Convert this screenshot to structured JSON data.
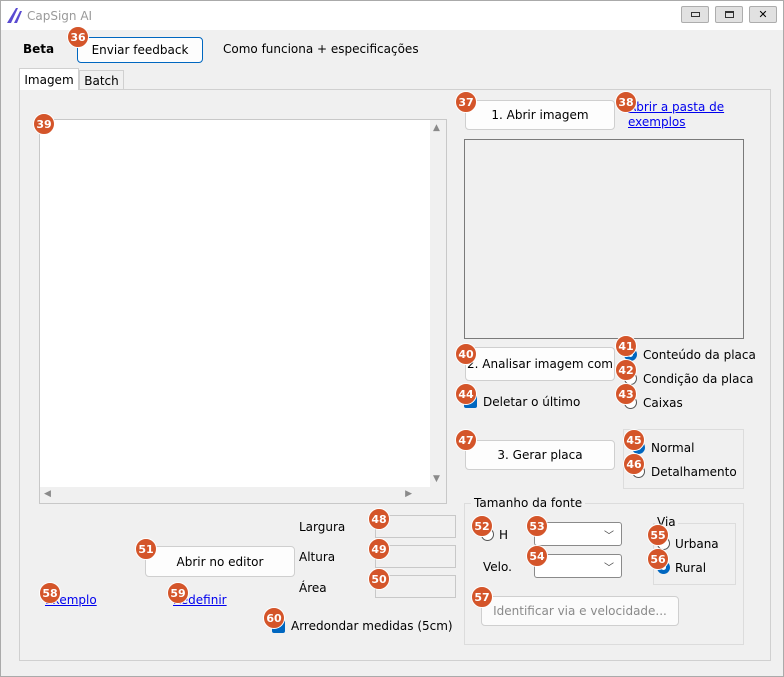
{
  "window": {
    "title": "CapSign AI",
    "controls": {
      "minimize": "▭",
      "maximize": "▢",
      "close": "✕"
    }
  },
  "header": {
    "beta_label": "Beta",
    "feedback_button": "Enviar feedback",
    "how_it_works_label": "Como funciona + especificações"
  },
  "tabs": [
    {
      "label": "Imagem",
      "active": true
    },
    {
      "label": "Batch",
      "active": false
    }
  ],
  "image_panel": {
    "scroll_up": "▲",
    "scroll_down": "▼",
    "scroll_left": "◀",
    "scroll_right": "▶"
  },
  "dimensions": {
    "width_label": "Largura",
    "height_label": "Altura",
    "area_label": "Área",
    "width_value": "",
    "height_value": "",
    "area_value": ""
  },
  "editor": {
    "open_editor_button": "Abrir no editor",
    "example_link": "Exemplo",
    "reset_link": "Redefinir",
    "round_measures_label": "Arredondar medidas (5cm)",
    "round_measures_checked": true
  },
  "steps": {
    "open_image_button": "1. Abrir imagem",
    "open_examples_link_line1": "Abrir a pasta de",
    "open_examples_link_line2": "exemplos",
    "analyze_button": "2. Analisar imagem com",
    "generate_button": "3. Gerar placa",
    "delete_last_label": "Deletar o último",
    "delete_last_checked": true
  },
  "analysis_options": [
    {
      "label": "Conteúdo da placa",
      "selected": true
    },
    {
      "label": "Condição da placa",
      "selected": false
    },
    {
      "label": "Caixas",
      "selected": false
    }
  ],
  "generate_options": [
    {
      "label": "Normal",
      "selected": true
    },
    {
      "label": "Detalhamento",
      "selected": false
    }
  ],
  "font_size": {
    "group_label": "Tamanho da fonte",
    "h_label": "H",
    "velo_label": "Velo.",
    "h_value": "",
    "velo_value": "",
    "identify_button": "Identificar via e velocidade..."
  },
  "road": {
    "group_label": "Via",
    "options": [
      {
        "label": "Urbana",
        "selected": false
      },
      {
        "label": "Rural",
        "selected": true
      }
    ]
  },
  "badges": {
    "feedback": "36",
    "open_image": "37",
    "open_examples": "38",
    "image_panel": "39",
    "analyze": "40",
    "content": "41",
    "condition": "42",
    "boxes": "43",
    "delete_last": "44",
    "normal": "45",
    "detail": "46",
    "generate": "47",
    "width": "48",
    "height": "49",
    "area": "50",
    "editor": "51",
    "h_radio": "52",
    "h_combo": "53",
    "velo_combo": "54",
    "urban": "55",
    "rural": "56",
    "identify": "57",
    "example": "58",
    "reset": "59",
    "round": "60"
  },
  "colors": {
    "accent": "#0067c0",
    "badge": "#d4552a",
    "link": "#0000ee"
  }
}
